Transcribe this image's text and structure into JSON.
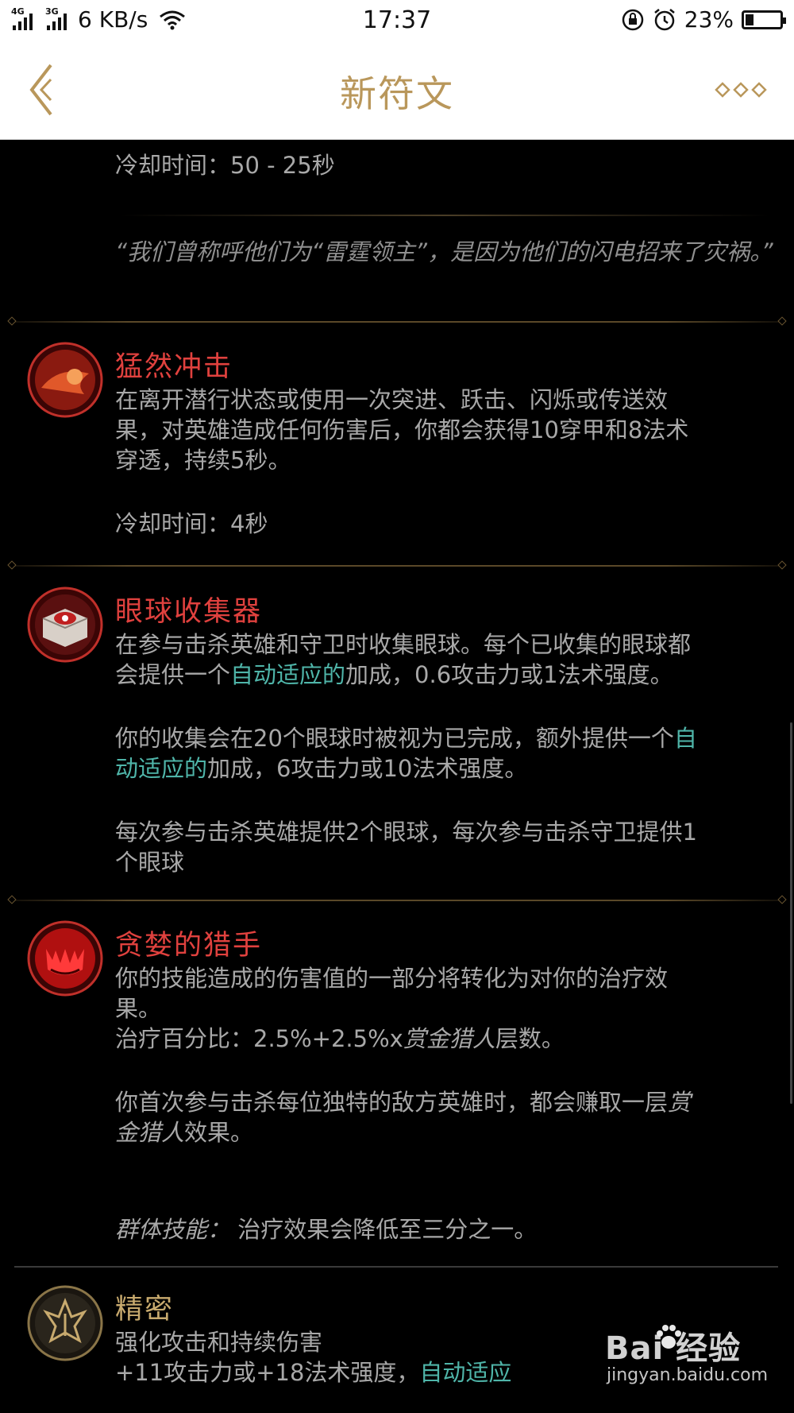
{
  "status_bar": {
    "signal_1": "4G",
    "signal_2": "3G",
    "speed": "6 KB/s",
    "time": "17:37",
    "battery": "23%",
    "battery_level": 0.23
  },
  "header": {
    "title": "新符文",
    "back_icon": "back-chevron-icon",
    "more_icon": "more-diamonds-icon"
  },
  "prev_rune": {
    "cooldown": "冷却时间：50 - 25秒",
    "quote": "“我们曾称呼他们为“雷霆领主”，是因为他们的闪电招来了灾祸。”"
  },
  "runes": [
    {
      "name": "猛然冲击",
      "desc_lines": [
        "在离开潜行状态或使用一次突进、跃击、闪烁或传送效",
        "果，对英雄造成任何伤害后，你都会获得10穿甲和8法术",
        "穿透，持续5秒。"
      ],
      "cooldown": "冷却时间：4秒",
      "icon": "sudden-impact-icon"
    },
    {
      "name": "眼球收集器",
      "line1": "在参与击杀英雄和守卫时收集眼球。每个已收集的眼球都",
      "line2_pre": "会提供一个",
      "line2_link": "自动适应的",
      "line2_post": "加成，0.6攻击力或1法术强度。",
      "line3_pre": "你的收集会在20个眼球时被视为已完成，额外提供一个",
      "line3_link": "自",
      "line4_link": "动适应的",
      "line4_post": "加成，6攻击力或10法术强度。",
      "line5": "每次参与击杀英雄提供2个眼球，每次参与击杀守卫提供1",
      "line6": "个眼球",
      "icon": "eyeball-collection-icon"
    },
    {
      "name": "贪婪的猎手",
      "line1": "你的技能造成的伤害值的一部分将转化为对你的治疗效",
      "line2": "果。",
      "line3_pre": "治疗百分比：2.5%+2.5%x",
      "line3_ital": "赏金猎人",
      "line3_post": "层数。",
      "line4_pre": "你首次参与击杀每位独特的敌方英雄时，都会赚取一层",
      "line4_ital": "赏",
      "line5_ital": "金猎人",
      "line5_post": "效果。",
      "aoe_label": "群体技能：",
      "aoe_text": "治疗效果会降低至三分之一。",
      "icon": "ravenous-hunter-icon"
    }
  ],
  "precision": {
    "name": "精密",
    "line1": "强化攻击和持续伤害",
    "line2_pre": "+11攻击力或+18法术强度，",
    "line2_link": "自动适应",
    "icon": "precision-icon"
  },
  "watermark": {
    "brand": "Bai  经验",
    "url": "jingyan.baidu.com"
  },
  "colors": {
    "accent_gold": "#b9975b",
    "rune_name_red": "#e0413e",
    "link_teal": "#4fb5a9",
    "text_grey": "#a8a8a8"
  }
}
